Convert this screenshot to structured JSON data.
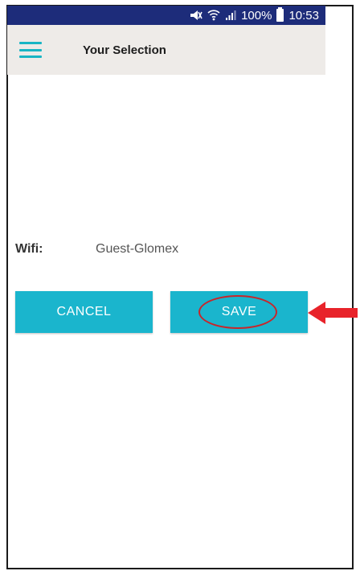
{
  "status_bar": {
    "battery": "100%",
    "time": "10:53",
    "icons": [
      "mute-icon",
      "wifi-icon",
      "signal-icon",
      "battery-icon"
    ],
    "background": "#1d2c7a"
  },
  "app_bar": {
    "title": "Your Selection",
    "menu_icon": "hamburger-menu-icon",
    "background": "#eeebe8",
    "accent": "#19b5c4"
  },
  "wifi": {
    "label": "Wifi:",
    "value": "Guest-Glomex"
  },
  "buttons": {
    "cancel_label": "CANCEL",
    "save_label": "SAVE",
    "color": "#1ab5cd"
  },
  "annotation": {
    "highlight_color": "#c8262a",
    "arrow_color": "#e8232a"
  }
}
